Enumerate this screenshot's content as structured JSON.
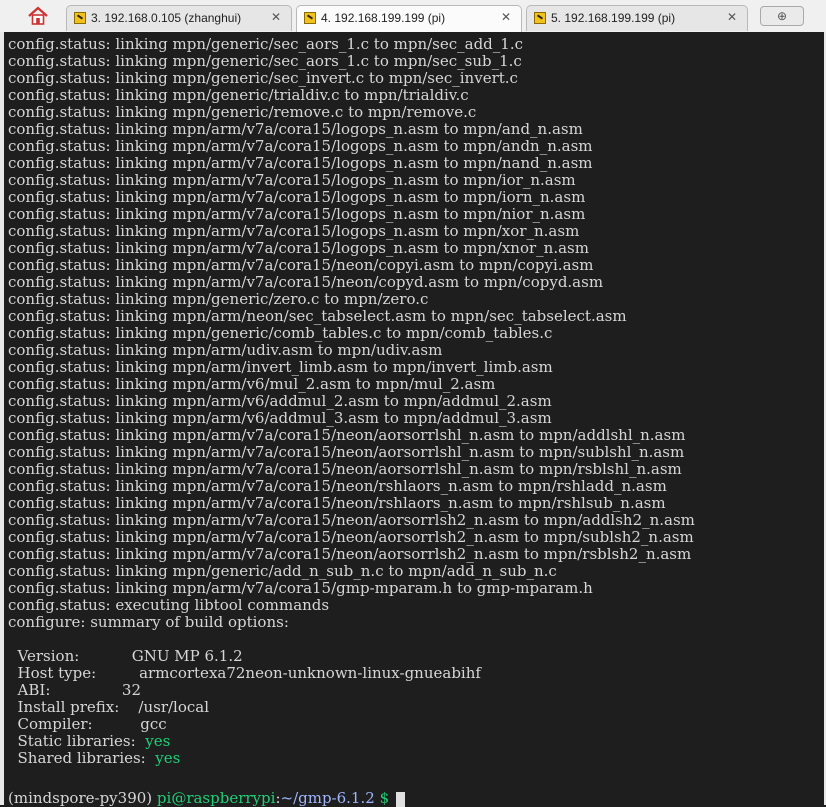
{
  "tabs": [
    {
      "label": "3. 192.168.0.105 (zhanghui)",
      "active": false
    },
    {
      "label": "4. 192.168.199.199 (pi)",
      "active": true
    },
    {
      "label": "5. 192.168.199.199 (pi)",
      "active": false
    }
  ],
  "terminal": {
    "lines": [
      "config.status: linking mpn/generic/sec_aors_1.c to mpn/sec_add_1.c",
      "config.status: linking mpn/generic/sec_aors_1.c to mpn/sec_sub_1.c",
      "config.status: linking mpn/generic/sec_invert.c to mpn/sec_invert.c",
      "config.status: linking mpn/generic/trialdiv.c to mpn/trialdiv.c",
      "config.status: linking mpn/generic/remove.c to mpn/remove.c",
      "config.status: linking mpn/arm/v7a/cora15/logops_n.asm to mpn/and_n.asm",
      "config.status: linking mpn/arm/v7a/cora15/logops_n.asm to mpn/andn_n.asm",
      "config.status: linking mpn/arm/v7a/cora15/logops_n.asm to mpn/nand_n.asm",
      "config.status: linking mpn/arm/v7a/cora15/logops_n.asm to mpn/ior_n.asm",
      "config.status: linking mpn/arm/v7a/cora15/logops_n.asm to mpn/iorn_n.asm",
      "config.status: linking mpn/arm/v7a/cora15/logops_n.asm to mpn/nior_n.asm",
      "config.status: linking mpn/arm/v7a/cora15/logops_n.asm to mpn/xor_n.asm",
      "config.status: linking mpn/arm/v7a/cora15/logops_n.asm to mpn/xnor_n.asm",
      "config.status: linking mpn/arm/v7a/cora15/neon/copyi.asm to mpn/copyi.asm",
      "config.status: linking mpn/arm/v7a/cora15/neon/copyd.asm to mpn/copyd.asm",
      "config.status: linking mpn/generic/zero.c to mpn/zero.c",
      "config.status: linking mpn/arm/neon/sec_tabselect.asm to mpn/sec_tabselect.asm",
      "config.status: linking mpn/generic/comb_tables.c to mpn/comb_tables.c",
      "config.status: linking mpn/arm/udiv.asm to mpn/udiv.asm",
      "config.status: linking mpn/arm/invert_limb.asm to mpn/invert_limb.asm",
      "config.status: linking mpn/arm/v6/mul_2.asm to mpn/mul_2.asm",
      "config.status: linking mpn/arm/v6/addmul_2.asm to mpn/addmul_2.asm",
      "config.status: linking mpn/arm/v6/addmul_3.asm to mpn/addmul_3.asm",
      "config.status: linking mpn/arm/v7a/cora15/neon/aorsorrlshl_n.asm to mpn/addlshl_n.asm",
      "config.status: linking mpn/arm/v7a/cora15/neon/aorsorrlshl_n.asm to mpn/sublshl_n.asm",
      "config.status: linking mpn/arm/v7a/cora15/neon/aorsorrlshl_n.asm to mpn/rsblshl_n.asm",
      "config.status: linking mpn/arm/v7a/cora15/neon/rshlaors_n.asm to mpn/rshladd_n.asm",
      "config.status: linking mpn/arm/v7a/cora15/neon/rshlaors_n.asm to mpn/rshlsub_n.asm",
      "config.status: linking mpn/arm/v7a/cora15/neon/aorsorrlsh2_n.asm to mpn/addlsh2_n.asm",
      "config.status: linking mpn/arm/v7a/cora15/neon/aorsorrlsh2_n.asm to mpn/sublsh2_n.asm",
      "config.status: linking mpn/arm/v7a/cora15/neon/aorsorrlsh2_n.asm to mpn/rsblsh2_n.asm",
      "config.status: linking mpn/generic/add_n_sub_n.c to mpn/add_n_sub_n.c",
      "config.status: linking mpn/arm/v7a/cora15/gmp-mparam.h to gmp-mparam.h",
      "config.status: executing libtool commands",
      "configure: summary of build options:"
    ],
    "summary": [
      {
        "key": "  Version:           ",
        "value": "GNU MP 6.1.2",
        "color": "normal"
      },
      {
        "key": "  Host type:         ",
        "value": "armcortexa72neon-unknown-linux-gnueabihf",
        "color": "normal"
      },
      {
        "key": "  ABI:               ",
        "value": "32",
        "color": "normal"
      },
      {
        "key": "  Install prefix:    ",
        "value": "/usr/local",
        "color": "normal"
      },
      {
        "key": "  Compiler:          ",
        "value": "gcc",
        "color": "normal"
      },
      {
        "key": "  Static libraries:  ",
        "value": "yes",
        "color": "green"
      },
      {
        "key": "  Shared libraries:  ",
        "value": "yes",
        "color": "green"
      }
    ],
    "prompt": {
      "env": "(mindspore-py390) ",
      "userhost": "pi@raspberrypi",
      "colon": ":",
      "path": "~/gmp-6.1.2",
      "dollar": " $ "
    }
  },
  "colors": {
    "green": "#1fcf76",
    "path": "#9fb6ff",
    "background": "#1e1e1e"
  }
}
